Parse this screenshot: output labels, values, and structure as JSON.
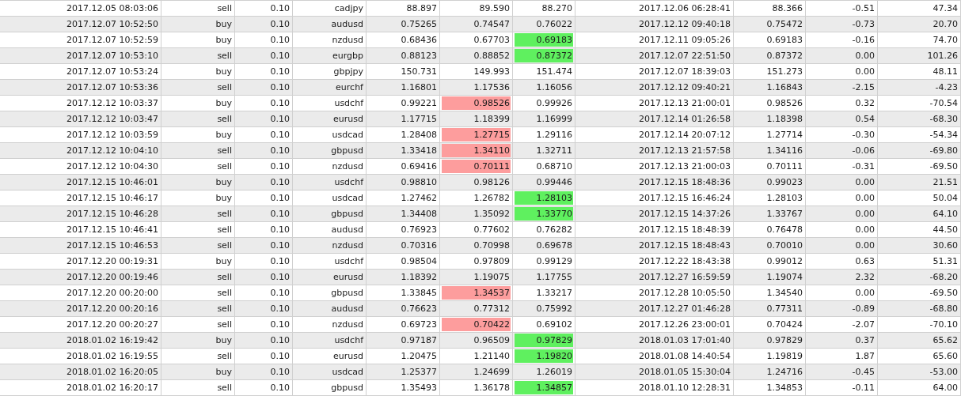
{
  "rows": [
    {
      "open_time": "2017.12.05 08:03:06",
      "type": "sell",
      "size": "0.10",
      "symbol": "cadjpy",
      "price": "88.897",
      "sl": "89.590",
      "sl_hit": false,
      "tp": "88.270",
      "tp_hit": false,
      "close_time": "2017.12.06 06:28:41",
      "close_price": "88.366",
      "swap": "-0.51",
      "profit": "47.34"
    },
    {
      "open_time": "2017.12.07 10:52:50",
      "type": "buy",
      "size": "0.10",
      "symbol": "audusd",
      "price": "0.75265",
      "sl": "0.74547",
      "sl_hit": false,
      "tp": "0.76022",
      "tp_hit": false,
      "close_time": "2017.12.12 09:40:18",
      "close_price": "0.75472",
      "swap": "-0.73",
      "profit": "20.70"
    },
    {
      "open_time": "2017.12.07 10:52:59",
      "type": "buy",
      "size": "0.10",
      "symbol": "nzdusd",
      "price": "0.68436",
      "sl": "0.67703",
      "sl_hit": false,
      "tp": "0.69183",
      "tp_hit": true,
      "close_time": "2017.12.11 09:05:26",
      "close_price": "0.69183",
      "swap": "-0.16",
      "profit": "74.70"
    },
    {
      "open_time": "2017.12.07 10:53:10",
      "type": "sell",
      "size": "0.10",
      "symbol": "eurgbp",
      "price": "0.88123",
      "sl": "0.88852",
      "sl_hit": false,
      "tp": "0.87372",
      "tp_hit": true,
      "close_time": "2017.12.07 22:51:50",
      "close_price": "0.87372",
      "swap": "0.00",
      "profit": "101.26"
    },
    {
      "open_time": "2017.12.07 10:53:24",
      "type": "buy",
      "size": "0.10",
      "symbol": "gbpjpy",
      "price": "150.731",
      "sl": "149.993",
      "sl_hit": false,
      "tp": "151.474",
      "tp_hit": false,
      "close_time": "2017.12.07 18:39:03",
      "close_price": "151.273",
      "swap": "0.00",
      "profit": "48.11"
    },
    {
      "open_time": "2017.12.07 10:53:36",
      "type": "sell",
      "size": "0.10",
      "symbol": "eurchf",
      "price": "1.16801",
      "sl": "1.17536",
      "sl_hit": false,
      "tp": "1.16056",
      "tp_hit": false,
      "close_time": "2017.12.12 09:40:21",
      "close_price": "1.16843",
      "swap": "-2.15",
      "profit": "-4.23"
    },
    {
      "open_time": "2017.12.12 10:03:37",
      "type": "buy",
      "size": "0.10",
      "symbol": "usdchf",
      "price": "0.99221",
      "sl": "0.98526",
      "sl_hit": true,
      "tp": "0.99926",
      "tp_hit": false,
      "close_time": "2017.12.13 21:00:01",
      "close_price": "0.98526",
      "swap": "0.32",
      "profit": "-70.54"
    },
    {
      "open_time": "2017.12.12 10:03:47",
      "type": "sell",
      "size": "0.10",
      "symbol": "eurusd",
      "price": "1.17715",
      "sl": "1.18399",
      "sl_hit": false,
      "tp": "1.16999",
      "tp_hit": false,
      "close_time": "2017.12.14 01:26:58",
      "close_price": "1.18398",
      "swap": "0.54",
      "profit": "-68.30"
    },
    {
      "open_time": "2017.12.12 10:03:59",
      "type": "buy",
      "size": "0.10",
      "symbol": "usdcad",
      "price": "1.28408",
      "sl": "1.27715",
      "sl_hit": true,
      "tp": "1.29116",
      "tp_hit": false,
      "close_time": "2017.12.14 20:07:12",
      "close_price": "1.27714",
      "swap": "-0.30",
      "profit": "-54.34"
    },
    {
      "open_time": "2017.12.12 10:04:10",
      "type": "sell",
      "size": "0.10",
      "symbol": "gbpusd",
      "price": "1.33418",
      "sl": "1.34110",
      "sl_hit": true,
      "tp": "1.32711",
      "tp_hit": false,
      "close_time": "2017.12.13 21:57:58",
      "close_price": "1.34116",
      "swap": "-0.06",
      "profit": "-69.80"
    },
    {
      "open_time": "2017.12.12 10:04:30",
      "type": "sell",
      "size": "0.10",
      "symbol": "nzdusd",
      "price": "0.69416",
      "sl": "0.70111",
      "sl_hit": true,
      "tp": "0.68710",
      "tp_hit": false,
      "close_time": "2017.12.13 21:00:03",
      "close_price": "0.70111",
      "swap": "-0.31",
      "profit": "-69.50"
    },
    {
      "open_time": "2017.12.15 10:46:01",
      "type": "buy",
      "size": "0.10",
      "symbol": "usdchf",
      "price": "0.98810",
      "sl": "0.98126",
      "sl_hit": false,
      "tp": "0.99446",
      "tp_hit": false,
      "close_time": "2017.12.15 18:48:36",
      "close_price": "0.99023",
      "swap": "0.00",
      "profit": "21.51"
    },
    {
      "open_time": "2017.12.15 10:46:17",
      "type": "buy",
      "size": "0.10",
      "symbol": "usdcad",
      "price": "1.27462",
      "sl": "1.26782",
      "sl_hit": false,
      "tp": "1.28103",
      "tp_hit": true,
      "close_time": "2017.12.15 16:46:24",
      "close_price": "1.28103",
      "swap": "0.00",
      "profit": "50.04"
    },
    {
      "open_time": "2017.12.15 10:46:28",
      "type": "sell",
      "size": "0.10",
      "symbol": "gbpusd",
      "price": "1.34408",
      "sl": "1.35092",
      "sl_hit": false,
      "tp": "1.33770",
      "tp_hit": true,
      "close_time": "2017.12.15 14:37:26",
      "close_price": "1.33767",
      "swap": "0.00",
      "profit": "64.10"
    },
    {
      "open_time": "2017.12.15 10:46:41",
      "type": "sell",
      "size": "0.10",
      "symbol": "audusd",
      "price": "0.76923",
      "sl": "0.77602",
      "sl_hit": false,
      "tp": "0.76282",
      "tp_hit": false,
      "close_time": "2017.12.15 18:48:39",
      "close_price": "0.76478",
      "swap": "0.00",
      "profit": "44.50"
    },
    {
      "open_time": "2017.12.15 10:46:53",
      "type": "sell",
      "size": "0.10",
      "symbol": "nzdusd",
      "price": "0.70316",
      "sl": "0.70998",
      "sl_hit": false,
      "tp": "0.69678",
      "tp_hit": false,
      "close_time": "2017.12.15 18:48:43",
      "close_price": "0.70010",
      "swap": "0.00",
      "profit": "30.60"
    },
    {
      "open_time": "2017.12.20 00:19:31",
      "type": "buy",
      "size": "0.10",
      "symbol": "usdchf",
      "price": "0.98504",
      "sl": "0.97809",
      "sl_hit": false,
      "tp": "0.99129",
      "tp_hit": false,
      "close_time": "2017.12.22 18:43:38",
      "close_price": "0.99012",
      "swap": "0.63",
      "profit": "51.31"
    },
    {
      "open_time": "2017.12.20 00:19:46",
      "type": "sell",
      "size": "0.10",
      "symbol": "eurusd",
      "price": "1.18392",
      "sl": "1.19075",
      "sl_hit": false,
      "tp": "1.17755",
      "tp_hit": false,
      "close_time": "2017.12.27 16:59:59",
      "close_price": "1.19074",
      "swap": "2.32",
      "profit": "-68.20"
    },
    {
      "open_time": "2017.12.20 00:20:00",
      "type": "sell",
      "size": "0.10",
      "symbol": "gbpusd",
      "price": "1.33845",
      "sl": "1.34537",
      "sl_hit": true,
      "tp": "1.33217",
      "tp_hit": false,
      "close_time": "2017.12.28 10:05:50",
      "close_price": "1.34540",
      "swap": "0.00",
      "profit": "-69.50"
    },
    {
      "open_time": "2017.12.20 00:20:16",
      "type": "sell",
      "size": "0.10",
      "symbol": "audusd",
      "price": "0.76623",
      "sl": "0.77312",
      "sl_hit": false,
      "tp": "0.75992",
      "tp_hit": false,
      "close_time": "2017.12.27 01:46:28",
      "close_price": "0.77311",
      "swap": "-0.89",
      "profit": "-68.80"
    },
    {
      "open_time": "2017.12.20 00:20:27",
      "type": "sell",
      "size": "0.10",
      "symbol": "nzdusd",
      "price": "0.69723",
      "sl": "0.70422",
      "sl_hit": true,
      "tp": "0.69102",
      "tp_hit": false,
      "close_time": "2017.12.26 23:00:01",
      "close_price": "0.70424",
      "swap": "-2.07",
      "profit": "-70.10"
    },
    {
      "open_time": "2018.01.02 16:19:42",
      "type": "buy",
      "size": "0.10",
      "symbol": "usdchf",
      "price": "0.97187",
      "sl": "0.96509",
      "sl_hit": false,
      "tp": "0.97829",
      "tp_hit": true,
      "close_time": "2018.01.03 17:01:40",
      "close_price": "0.97829",
      "swap": "0.37",
      "profit": "65.62"
    },
    {
      "open_time": "2018.01.02 16:19:55",
      "type": "sell",
      "size": "0.10",
      "symbol": "eurusd",
      "price": "1.20475",
      "sl": "1.21140",
      "sl_hit": false,
      "tp": "1.19820",
      "tp_hit": true,
      "close_time": "2018.01.08 14:40:54",
      "close_price": "1.19819",
      "swap": "1.87",
      "profit": "65.60"
    },
    {
      "open_time": "2018.01.02 16:20:05",
      "type": "buy",
      "size": "0.10",
      "symbol": "usdcad",
      "price": "1.25377",
      "sl": "1.24699",
      "sl_hit": false,
      "tp": "1.26019",
      "tp_hit": false,
      "close_time": "2018.01.05 15:30:04",
      "close_price": "1.24716",
      "swap": "-0.45",
      "profit": "-53.00"
    },
    {
      "open_time": "2018.01.02 16:20:17",
      "type": "sell",
      "size": "0.10",
      "symbol": "gbpusd",
      "price": "1.35493",
      "sl": "1.36178",
      "sl_hit": false,
      "tp": "1.34857",
      "tp_hit": true,
      "close_time": "2018.01.10 12:28:31",
      "close_price": "1.34853",
      "swap": "-0.11",
      "profit": "64.00"
    }
  ]
}
